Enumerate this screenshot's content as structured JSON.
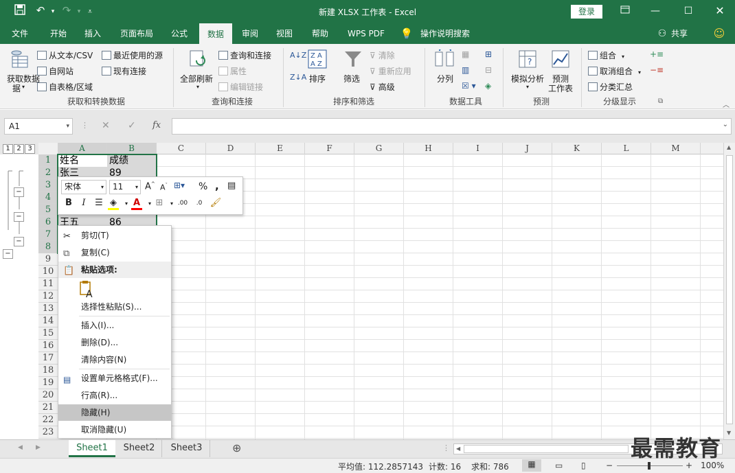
{
  "window": {
    "title": "新建 XLSX 工作表  -  Excel",
    "login_label": "登录"
  },
  "tabs": [
    "文件",
    "开始",
    "插入",
    "页面布局",
    "公式",
    "数据",
    "审阅",
    "视图",
    "帮助",
    "WPS PDF",
    "操作说明搜索"
  ],
  "share_label": "共享",
  "ribbon": {
    "get_data": "获取数据",
    "get_data_2": "据",
    "from_text": "从文本/CSV",
    "from_web": "自网站",
    "from_table": "自表格/区域",
    "recent_sources": "最近使用的源",
    "existing_connections": "现有连接",
    "group_get_transform": "获取和转换数据",
    "refresh_all": "全部刷新",
    "queries_connections": "查询和连接",
    "properties": "属性",
    "edit_links": "编辑链接",
    "group_queries": "查询和连接",
    "sort": "排序",
    "filter": "筛选",
    "clear": "清除",
    "reapply": "重新应用",
    "advanced": "高级",
    "group_sort_filter": "排序和筛选",
    "text_to_columns": "分列",
    "group_data_tools": "数据工具",
    "what_if": "模拟分析",
    "forecast_sheet_1": "预测",
    "forecast_sheet_2": "工作表",
    "group_forecast": "预测",
    "group": "组合",
    "ungroup": "取消组合",
    "subtotal": "分类汇总",
    "group_outline": "分级显示"
  },
  "formula_bar": {
    "name_box": "A1",
    "fx": "fx",
    "value": ""
  },
  "outline_levels": [
    "1",
    "2",
    "3"
  ],
  "columns": [
    "A",
    "B",
    "C",
    "D",
    "E",
    "F",
    "G",
    "H",
    "I",
    "J",
    "K",
    "L",
    "M"
  ],
  "rows": [
    "1",
    "2",
    "3",
    "4",
    "5",
    "6",
    "7",
    "8",
    "9",
    "10",
    "11",
    "12",
    "13",
    "14",
    "15",
    "16",
    "17",
    "18",
    "19",
    "20",
    "21",
    "22",
    "23"
  ],
  "cells": [
    {
      "ref": "A1",
      "text": "姓名"
    },
    {
      "ref": "B1",
      "text": "成绩"
    },
    {
      "ref": "A2",
      "text": "张三"
    },
    {
      "ref": "B2",
      "text": "89"
    },
    {
      "ref": "A6",
      "text": "王五"
    },
    {
      "ref": "B6",
      "text": "86"
    }
  ],
  "mini_toolbar": {
    "font_name": "宋体",
    "font_size": "11",
    "percent": "%",
    "comma": ",",
    "bold": "B",
    "italic": "I"
  },
  "context_menu": {
    "cut": "剪切(T)",
    "copy": "复制(C)",
    "paste_options": "粘贴选项:",
    "paste_special": "选择性粘贴(S)...",
    "insert": "插入(I)...",
    "delete": "删除(D)...",
    "clear_contents": "清除内容(N)",
    "format_cells": "设置单元格格式(F)...",
    "row_height": "行高(R)...",
    "hide": "隐藏(H)",
    "unhide": "取消隐藏(U)"
  },
  "sheets": [
    "Sheet1",
    "Sheet2",
    "Sheet3"
  ],
  "status": {
    "average": "平均值: 112.2857143",
    "count": "计数: 16",
    "sum": "求和: 786",
    "zoom": "100%"
  },
  "watermark": "最需教育",
  "colors": {
    "accent": "#217346"
  }
}
